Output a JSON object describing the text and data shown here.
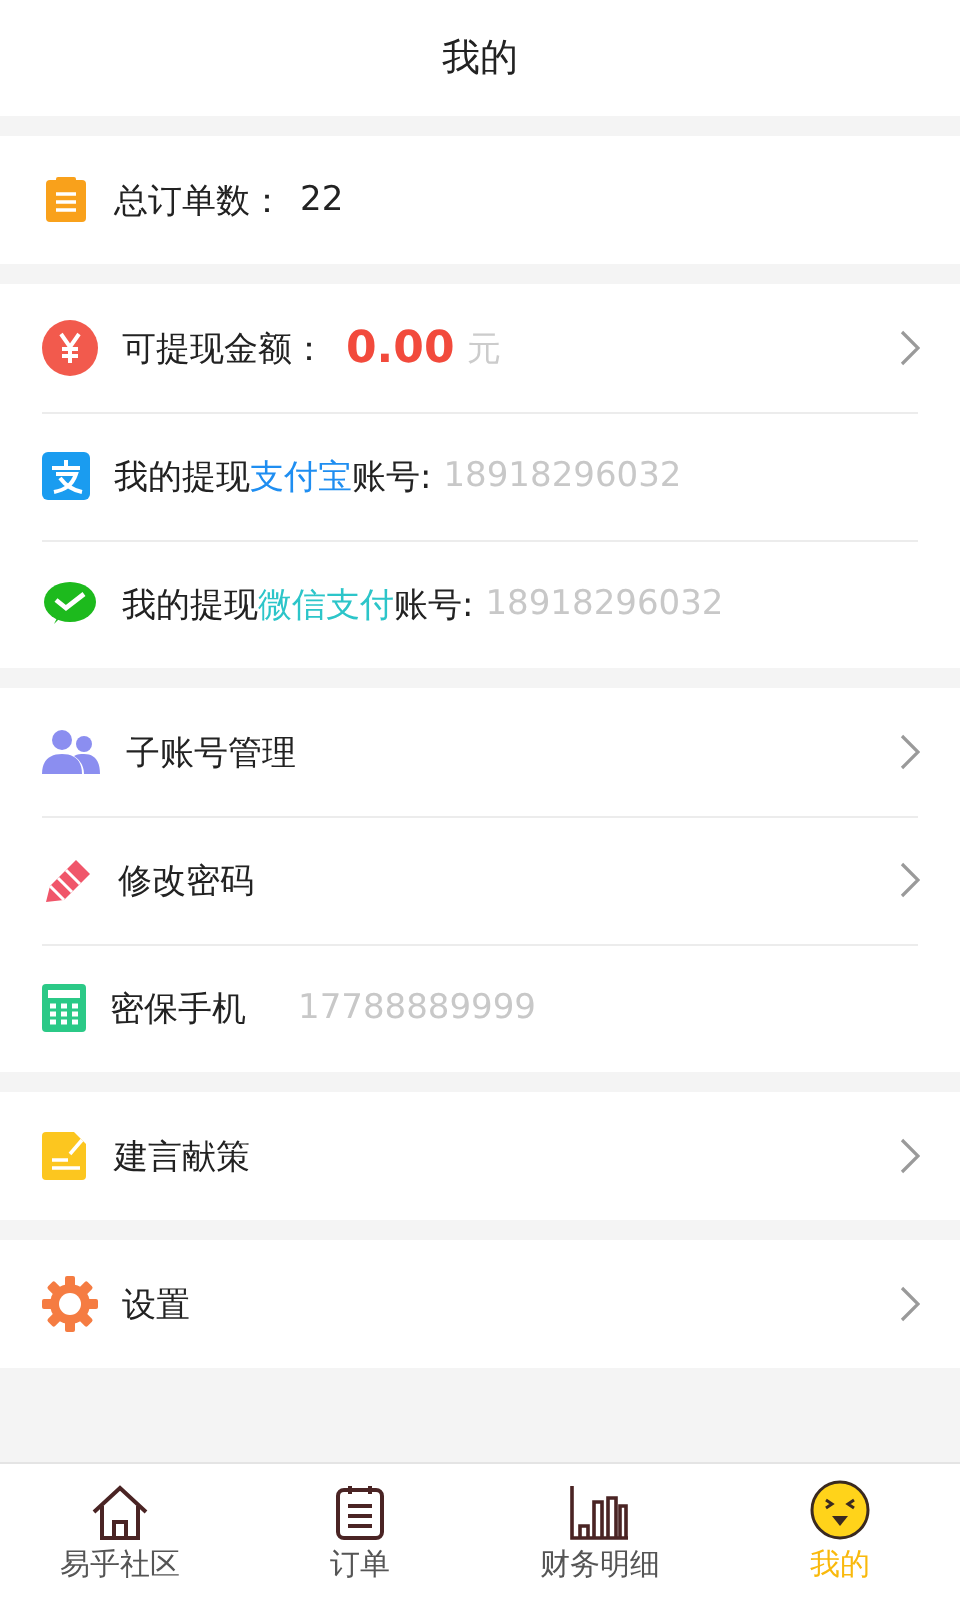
{
  "header": {
    "title": "我的"
  },
  "sections": [
    {
      "rows": [
        {
          "kind": "count",
          "label": "总订单数：",
          "value": "22",
          "arrow": false
        }
      ]
    },
    {
      "rows": [
        {
          "kind": "amount",
          "label": "可提现金额：",
          "value": "0.00",
          "unit": "元",
          "arrow": true
        },
        {
          "kind": "account",
          "label_parts": [
            {
              "text": "我的提现"
            },
            {
              "text": "支付宝",
              "color": "#1f8ef1"
            },
            {
              "text": "账号:"
            }
          ],
          "value": "18918296032",
          "arrow": false
        },
        {
          "kind": "account",
          "label_parts": [
            {
              "text": "我的提现"
            },
            {
              "text": "微信支付",
              "color": "#2cc5c9"
            },
            {
              "text": "账号:"
            }
          ],
          "value": "18918296032",
          "arrow": false
        }
      ]
    },
    {
      "rows": [
        {
          "kind": "link",
          "label": "子账号管理",
          "arrow": true
        },
        {
          "kind": "link",
          "label": "修改密码",
          "arrow": true
        },
        {
          "kind": "phone",
          "label": "密保手机",
          "value": "17788889999",
          "arrow": false
        }
      ]
    },
    {
      "rows": [
        {
          "kind": "link",
          "label": "建言献策",
          "arrow": true
        }
      ]
    },
    {
      "rows": [
        {
          "kind": "link",
          "label": "设置",
          "arrow": true
        }
      ]
    }
  ],
  "tabbar": [
    {
      "label": "易乎社区",
      "selected": false
    },
    {
      "label": "订单",
      "selected": false
    },
    {
      "label": "财务明细",
      "selected": false
    },
    {
      "label": "我的",
      "selected": true
    }
  ]
}
